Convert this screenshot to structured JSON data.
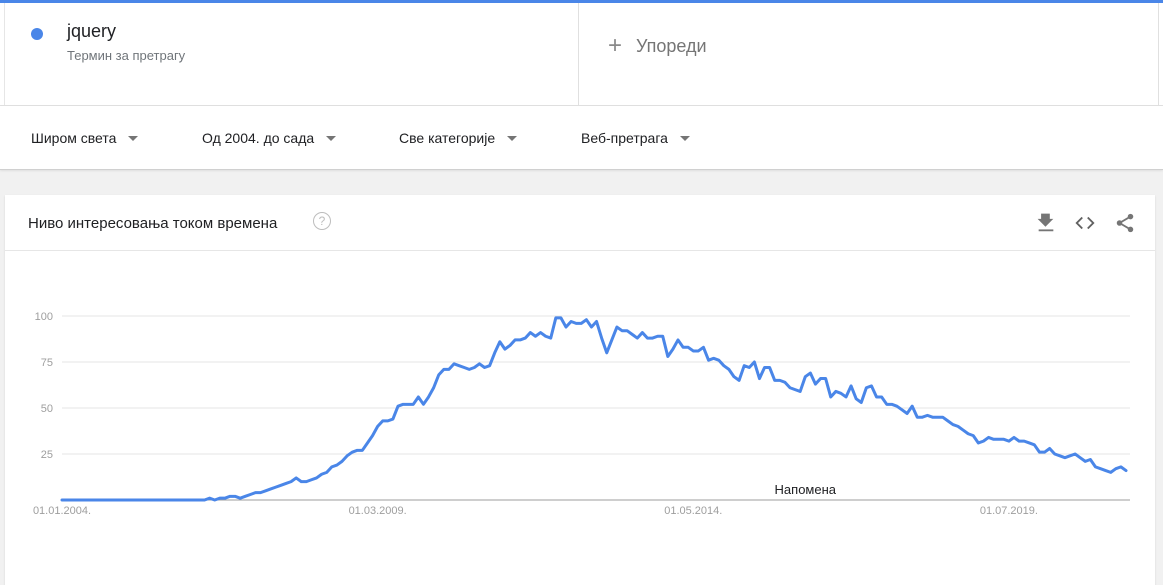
{
  "search": {
    "term": "jquery",
    "term_sub": "Термин за претрагу",
    "compare_label": "Упореди",
    "term_color": "#4a86e8"
  },
  "filters": {
    "region": "Широм света",
    "time": "Од 2004. до сада",
    "category": "Све категорије",
    "property": "Веб-претрага"
  },
  "card": {
    "title": "Ниво интересовања током времена",
    "help_icon": "help-circle-icon",
    "actions": [
      "download-icon",
      "embed-icon",
      "share-icon"
    ]
  },
  "chart_data": {
    "type": "line",
    "title": "",
    "xlabel": "",
    "ylabel": "",
    "ylim": [
      0,
      100
    ],
    "y_ticks": [
      25,
      50,
      75,
      100
    ],
    "x_ticks": [
      "01.01.2004.",
      "01.03.2009.",
      "01.05.2014.",
      "01.07.2019."
    ],
    "x_tick_month_index": [
      0,
      62,
      124,
      186
    ],
    "annotation": {
      "text": "Напомена",
      "month_index": 146
    },
    "grid": true,
    "color": "#4a86e8",
    "x_start": "01.01.2004.",
    "x_step": "1 month",
    "series": [
      {
        "name": "jquery",
        "values": [
          0,
          0,
          0,
          0,
          0,
          0,
          0,
          0,
          0,
          0,
          0,
          0,
          0,
          0,
          0,
          0,
          0,
          0,
          0,
          0,
          0,
          0,
          0,
          0,
          0,
          0,
          0,
          0,
          0,
          1,
          0,
          1,
          1,
          2,
          2,
          1,
          2,
          3,
          4,
          4,
          5,
          6,
          7,
          8,
          9,
          10,
          12,
          10,
          10,
          11,
          12,
          14,
          15,
          18,
          19,
          21,
          24,
          26,
          27,
          27,
          31,
          35,
          40,
          43,
          43,
          44,
          51,
          52,
          52,
          52,
          56,
          52,
          56,
          61,
          68,
          71,
          71,
          74,
          73,
          72,
          71,
          72,
          74,
          72,
          73,
          80,
          86,
          82,
          84,
          87,
          87,
          88,
          91,
          89,
          91,
          89,
          88,
          99,
          99,
          94,
          97,
          96,
          96,
          98,
          94,
          97,
          88,
          80,
          87,
          94,
          92,
          92,
          90,
          88,
          91,
          88,
          88,
          89,
          89,
          78,
          82,
          87,
          83,
          83,
          81,
          81,
          83,
          76,
          77,
          76,
          73,
          71,
          67,
          65,
          73,
          72,
          75,
          66,
          72,
          72,
          65,
          65,
          64,
          61,
          60,
          59,
          67,
          69,
          63,
          66,
          66,
          56,
          59,
          58,
          56,
          62,
          55,
          53,
          61,
          62,
          56,
          56,
          52,
          52,
          51,
          49,
          47,
          51,
          45,
          45,
          46,
          45,
          45,
          45,
          43,
          41,
          40,
          38,
          36,
          35,
          31,
          32,
          34,
          33,
          33,
          33,
          32,
          34,
          32,
          32,
          31,
          30,
          26,
          26,
          28,
          25,
          24,
          23,
          24,
          25,
          23,
          21,
          22,
          18,
          17,
          16,
          15,
          17,
          18,
          16
        ]
      }
    ]
  }
}
